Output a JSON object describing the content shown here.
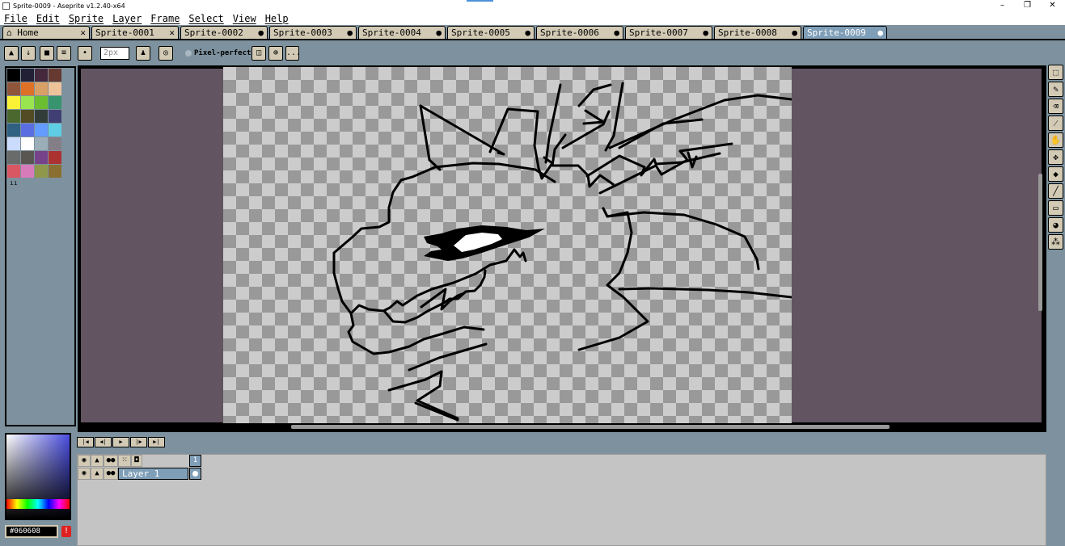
{
  "window": {
    "title": "Sprite-0009 - Aseprite v1.2.40-x64",
    "minimize": "–",
    "restore": "❐",
    "close": "✕"
  },
  "menu": [
    "File",
    "Edit",
    "Sprite",
    "Layer",
    "Frame",
    "Select",
    "View",
    "Help"
  ],
  "tabs": {
    "home": "Home",
    "sprites": [
      "Sprite-0001",
      "Sprite-0002",
      "Sprite-0003",
      "Sprite-0004",
      "Sprite-0005",
      "Sprite-0006",
      "Sprite-0007",
      "Sprite-0008",
      "Sprite-0009"
    ],
    "active": "Sprite-0009"
  },
  "toolbar": {
    "brush_size": "2px",
    "pixel_perfect_label": "Pixel-perfect",
    "more_label": "..."
  },
  "color": {
    "foreground_hex": "#060608",
    "warn_icon": "!"
  },
  "palette": [
    "#000000",
    "#222034",
    "#45283c",
    "#663931",
    "#8f563b",
    "#df7126",
    "#d9a066",
    "#eec39a",
    "#fbf236",
    "#99e550",
    "#6abe30",
    "#37946e",
    "#4b692f",
    "#524b24",
    "#323c39",
    "#3f3f74",
    "#306082",
    "#5b6ee1",
    "#639bff",
    "#5fcde4",
    "#cbdbfc",
    "#ffffff",
    "#9badb7",
    "#847e87",
    "#696a6a",
    "#595652",
    "#76428a",
    "#ac3232",
    "#d95763",
    "#d77bba",
    "#8f974a",
    "#8a6f30"
  ],
  "timeline": {
    "frame_number": "1",
    "layer_name": "Layer 1"
  }
}
